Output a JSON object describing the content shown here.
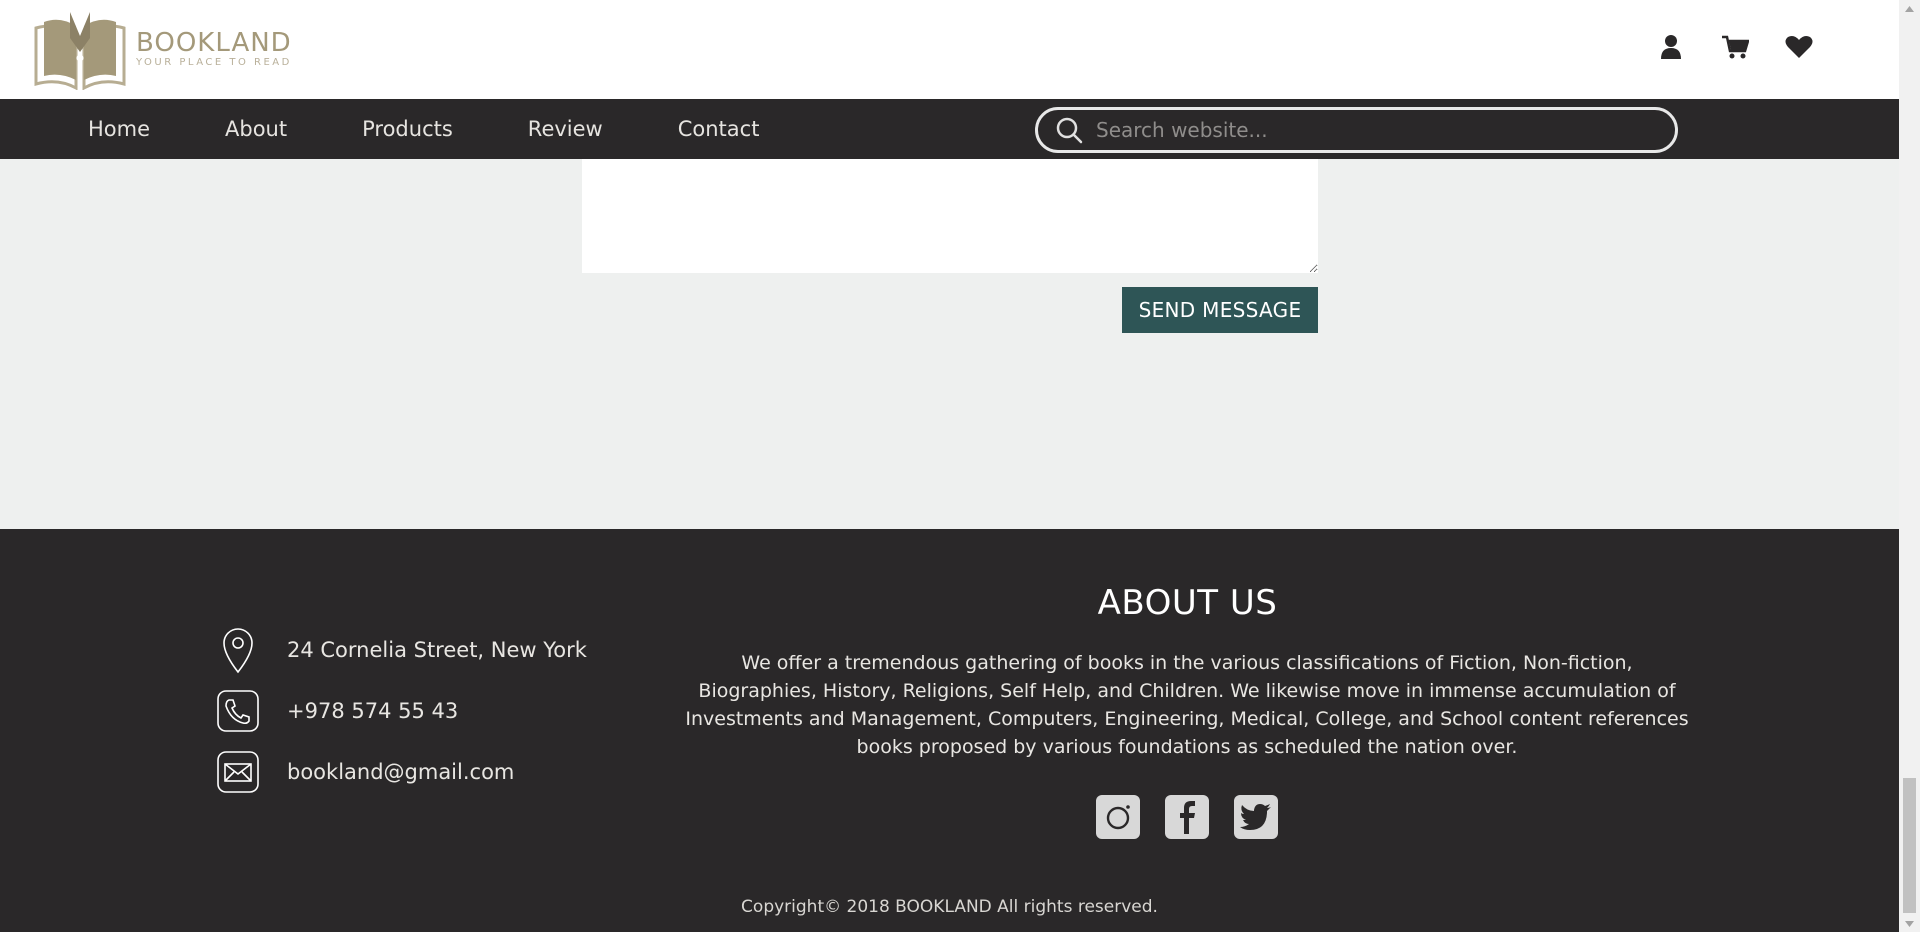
{
  "header": {
    "logo_name": "BOOKLAND",
    "logo_tagline": "YOUR PLACE TO READ",
    "icons": [
      "user-icon",
      "cart-icon",
      "heart-icon"
    ]
  },
  "nav": {
    "items": [
      {
        "label": "Home"
      },
      {
        "label": "About"
      },
      {
        "label": "Products"
      },
      {
        "label": "Review"
      },
      {
        "label": "Contact"
      }
    ],
    "search_placeholder": "Search website..."
  },
  "form": {
    "send_label": "SEND MESSAGE"
  },
  "footer": {
    "contacts": [
      {
        "icon": "location-pin-icon",
        "text": "24 Cornelia Street, New York"
      },
      {
        "icon": "phone-icon",
        "text": "+978 574 55 43"
      },
      {
        "icon": "mail-icon",
        "text": "bookland@gmail.com"
      }
    ],
    "about_title": "ABOUT US",
    "about_text": "We offer a tremendous gathering of books in the various classifications of Fiction, Non-fiction, Biographies, History, Religions, Self Help, and Children. We likewise move in immense accumulation of Investments and Management, Computers, Engineering, Medical, College, and School content references books proposed by various foundations as scheduled the nation over.",
    "socials": [
      "instagram-icon",
      "facebook-icon",
      "twitter-icon"
    ],
    "copyright": "Copyright© 2018 BOOKLAND All rights reserved."
  },
  "colors": {
    "nav_bg": "#2a2829",
    "page_bg": "#eef0ef",
    "brand_gold": "#a4997a",
    "button_teal": "#2e5556"
  }
}
